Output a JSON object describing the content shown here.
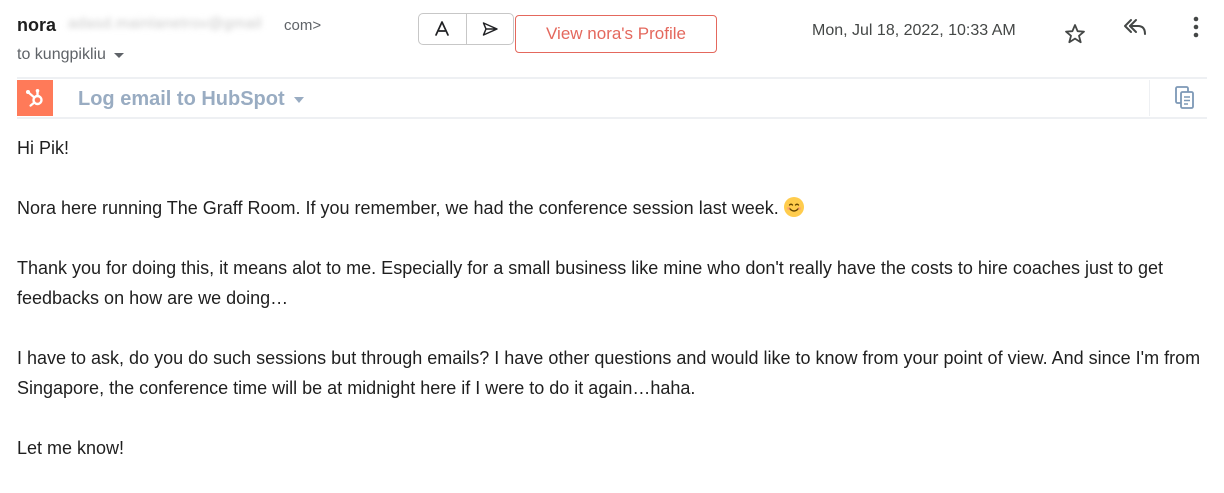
{
  "header": {
    "sender_name": "nora",
    "sender_email_hidden": "adasd.mainlanetrov@gmail",
    "sender_email_end": "com>",
    "recipient_line": "to kungpikliu",
    "profile_button": "View nora's Profile",
    "date": "Mon, Jul 18, 2022, 10:33 AM",
    "icons": [
      "ai-assist-icon",
      "send-icon",
      "star-icon",
      "reply-icon",
      "more-vert-icon"
    ]
  },
  "hubspot": {
    "label": "Log email to HubSpot",
    "accent_color": "#ff7a59",
    "icons": [
      "hubspot-logo-icon",
      "copy-icon"
    ]
  },
  "message": {
    "greeting": "Hi Pik!",
    "para1": "Nora here running The Graff Room. If you remember, we had the conference session last week.",
    "para2": "Thank you for doing this, it means alot to me. Especially for a small business like mine who don't really have the costs to hire coaches just to get feedbacks on how are we doing…",
    "para3": "I have to ask, do you do such sessions but through emails? I have other questions and would like to know from your point of view. And since I'm from Singapore, the conference time will be at midnight here if I were to do it again…haha.",
    "closing": "Let me know!"
  },
  "colors": {
    "profile_button": "#e4685d",
    "hubspot_label": "#99acc2"
  }
}
